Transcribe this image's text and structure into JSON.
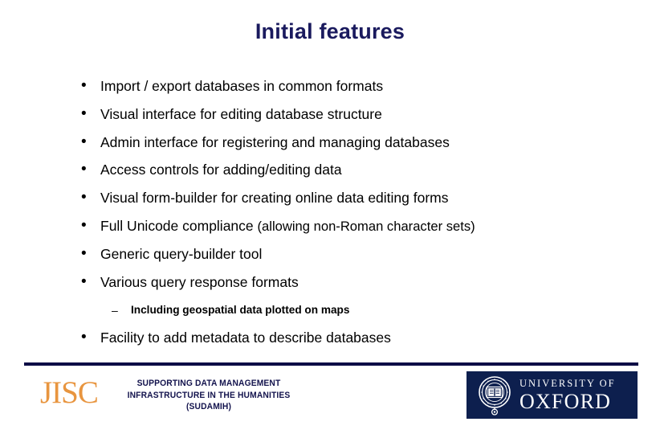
{
  "slide": {
    "title": "Initial features",
    "background_color": "#ffffff",
    "title_color": "#1a1a5e",
    "bullet_marker": "•",
    "sub_bullet_marker": "–",
    "bullets": [
      {
        "text": "Import / export databases in common formats",
        "level": 1
      },
      {
        "text": "Visual interface for editing database structure",
        "level": 1
      },
      {
        "text": "Admin interface for registering and managing databases",
        "level": 1
      },
      {
        "text": "Access controls for adding/editing data",
        "level": 1
      },
      {
        "text": "Visual form-builder for creating online data editing forms",
        "level": 1
      },
      {
        "text": "Full Unicode compliance ",
        "text_small": "(allowing non-Roman character sets)",
        "level": 1
      },
      {
        "text": "Generic query-builder tool",
        "level": 1
      },
      {
        "text": "Various query response formats",
        "level": 1
      },
      {
        "text": "Including geospatial data plotted on maps",
        "level": 2
      },
      {
        "text": "Facility to add metadata to describe databases",
        "level": 1
      }
    ]
  },
  "footer": {
    "rule_color": "#0d0d46",
    "jisc": {
      "wordmark": "JISC",
      "color": "#e8953f"
    },
    "project": {
      "line1": "SUPPORTING DATA MANAGEMENT",
      "line2": "INFRASTRUCTURE IN THE HUMANITIES",
      "line3": "(SUDAMIH)",
      "color": "#13134d"
    },
    "oxford": {
      "line1": "UNIVERSITY OF",
      "line2": "OXFORD",
      "background_color": "#0d1f4e",
      "text_color": "#ffffff"
    }
  }
}
